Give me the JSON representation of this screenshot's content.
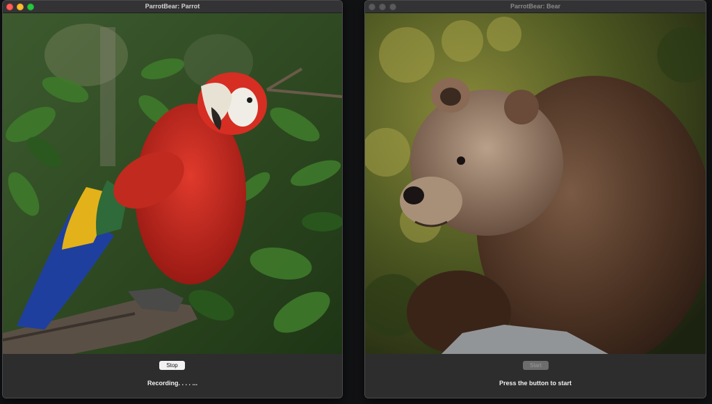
{
  "windows": {
    "parrot": {
      "title": "ParrotBear: Parrot",
      "image_subject": "scarlet macaw parrot on branch",
      "button_label": "Stop",
      "status_text": "Recording. . . . ..."
    },
    "bear": {
      "title": "ParrotBear: Bear",
      "image_subject": "brown bear resting on rock",
      "button_label": "Start",
      "status_text": "Press the button to start"
    }
  },
  "colors": {
    "close": "#ff5f57",
    "minimize": "#febc2e",
    "zoom": "#28c840",
    "window_bg": "#2d2d2d",
    "parrot_red": "#c9241c",
    "bear_brown": "#4a3122"
  }
}
